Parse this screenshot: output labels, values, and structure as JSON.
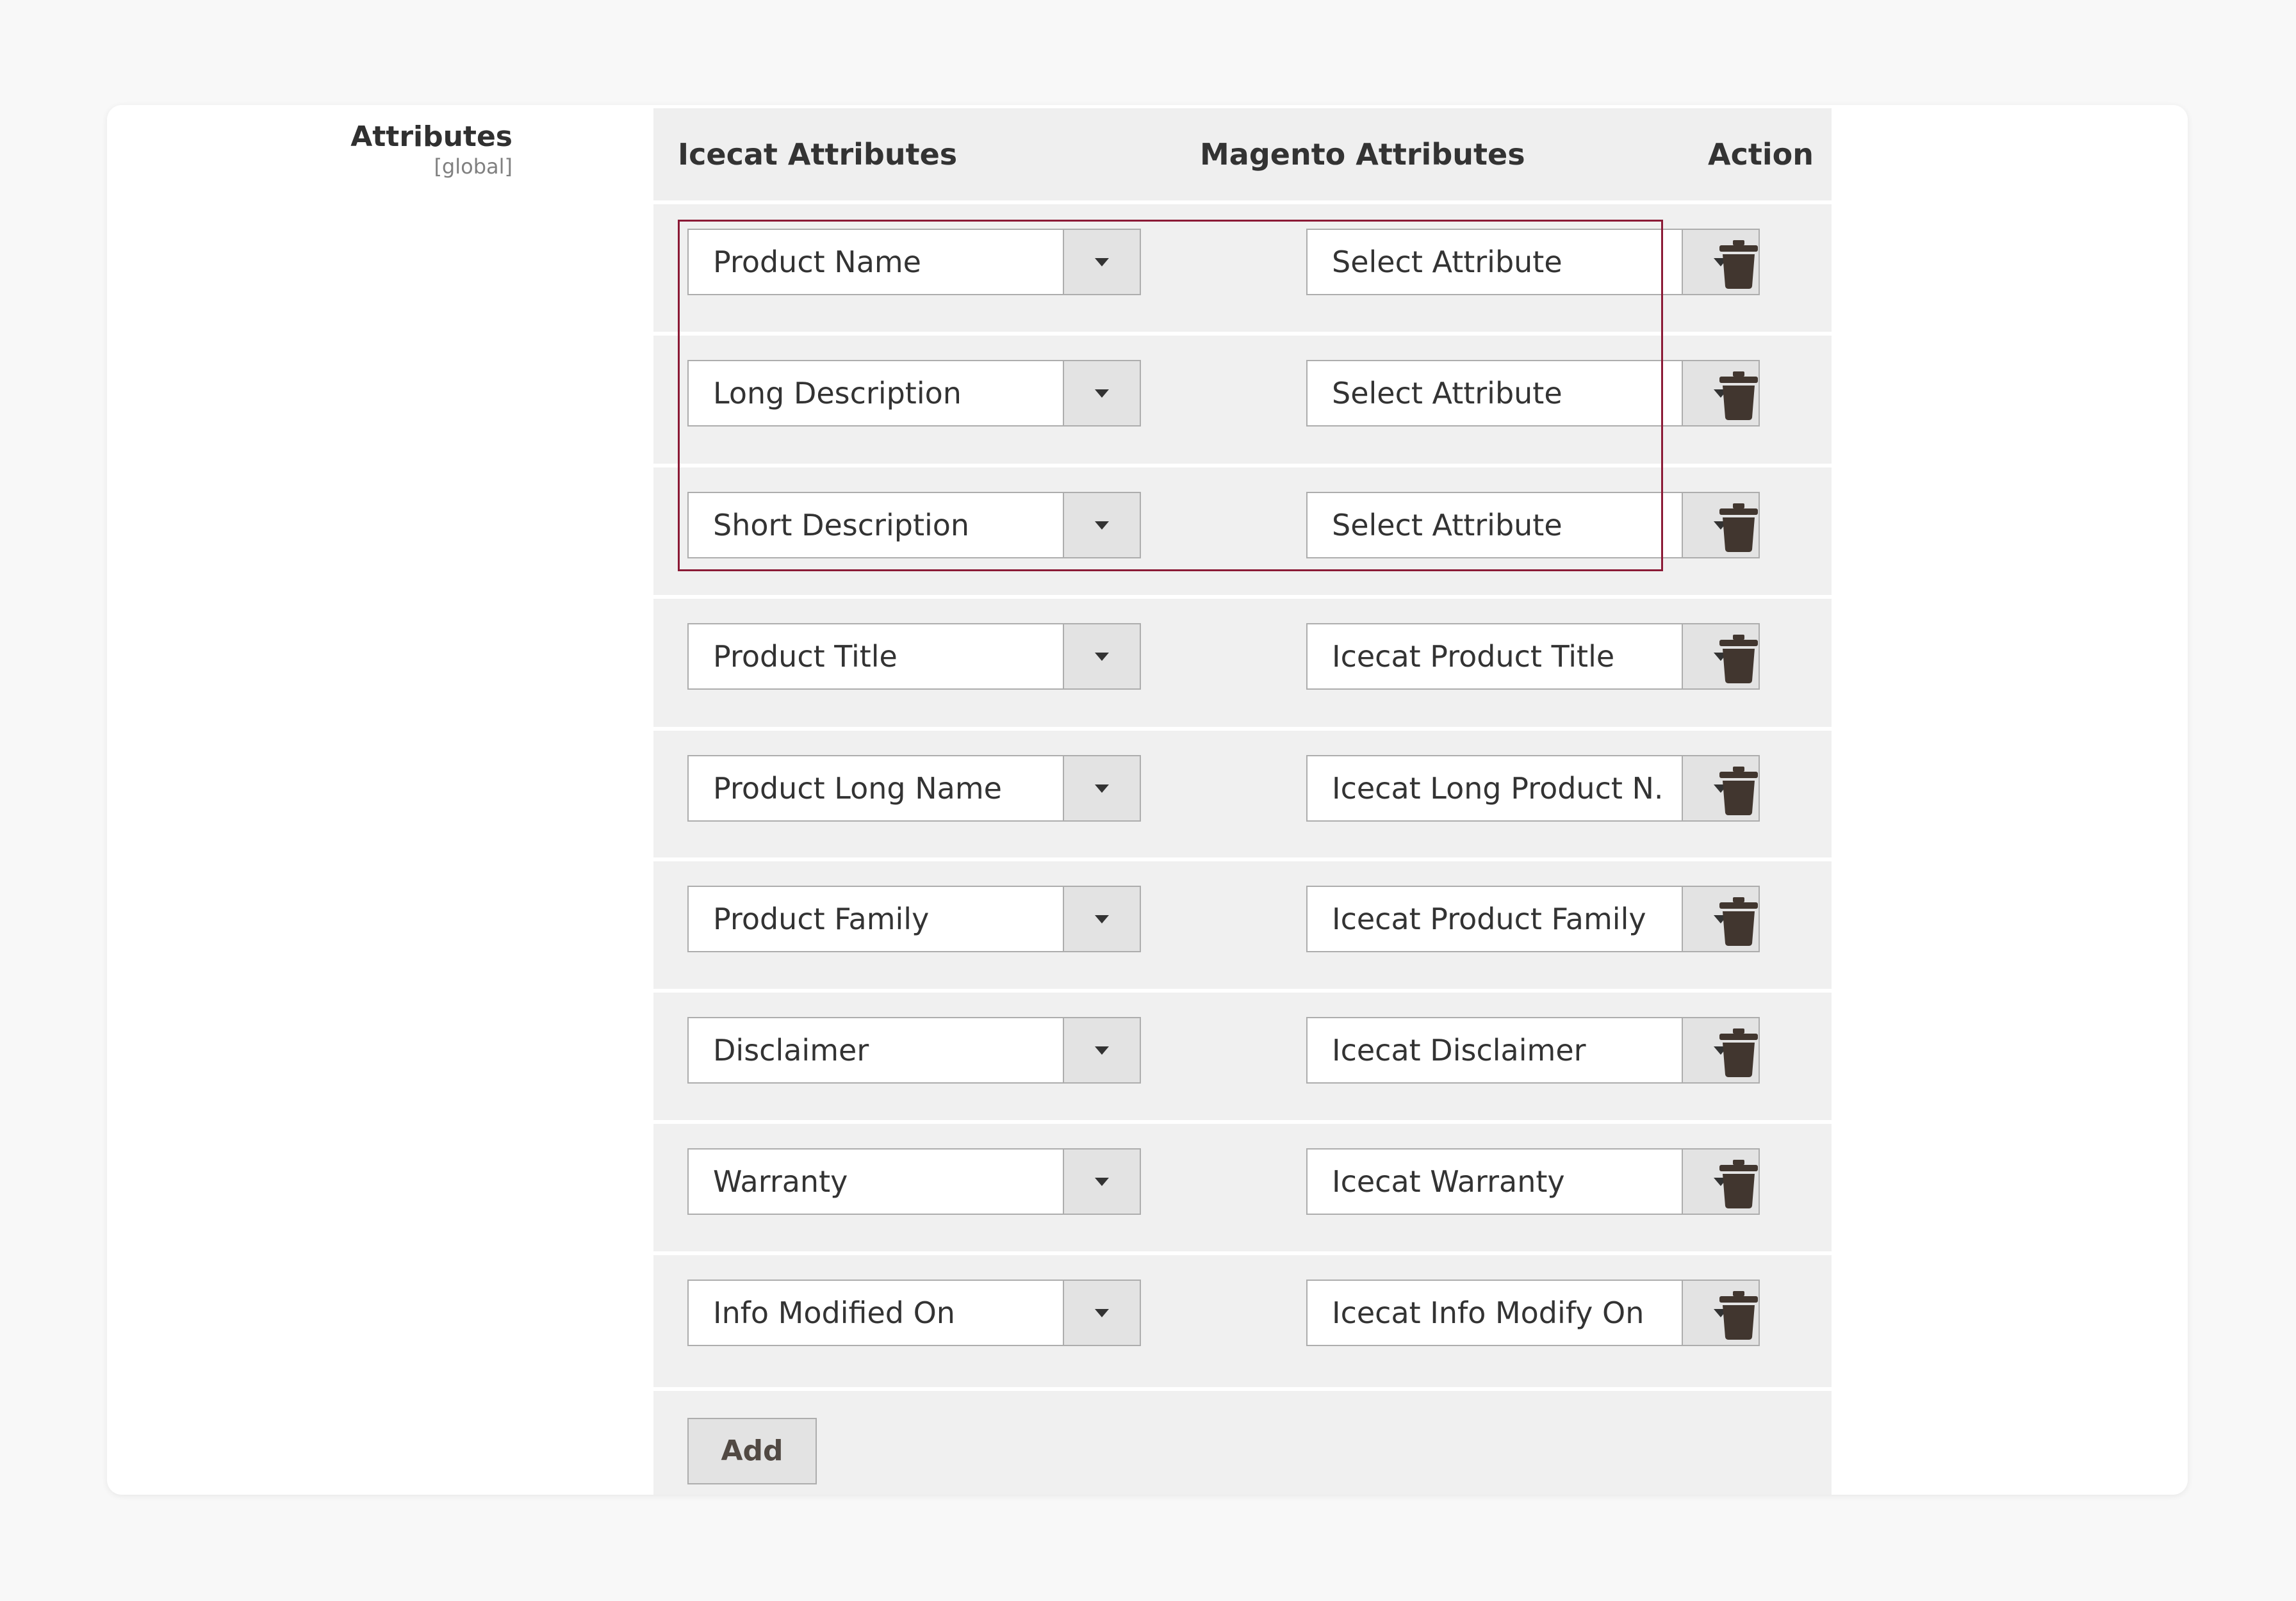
{
  "field": {
    "label": "Attributes",
    "scope": "[global]"
  },
  "table": {
    "headers": {
      "icecat": "Icecat Attributes",
      "magento": "Magento Attributes",
      "action": "Action"
    },
    "rows": [
      {
        "icecat": "Product Name",
        "magento": "Select Attribute"
      },
      {
        "icecat": "Long Description",
        "magento": "Select Attribute"
      },
      {
        "icecat": "Short Description",
        "magento": "Select Attribute"
      },
      {
        "icecat": "Product Title",
        "magento": "Icecat Product Title"
      },
      {
        "icecat": "Product Long Name",
        "magento": "Icecat Long Product N."
      },
      {
        "icecat": "Product Family",
        "magento": "Icecat Product Family"
      },
      {
        "icecat": "Disclaimer",
        "magento": "Icecat Disclaimer"
      },
      {
        "icecat": "Warranty",
        "magento": "Icecat Warranty"
      },
      {
        "icecat": "Info Modified On",
        "magento": "Icecat Info Modify On"
      }
    ],
    "add_label": "Add"
  },
  "icons": {
    "delete": "trash-icon",
    "dropdown": "chevron-down-icon"
  },
  "colors": {
    "highlight_border": "#8b1a36",
    "grid_background": "#efefef",
    "trash_icon": "#41362f"
  }
}
